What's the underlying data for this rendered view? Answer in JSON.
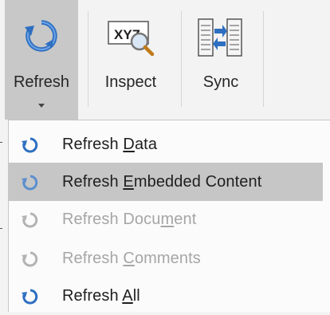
{
  "ribbon": {
    "buttons": [
      {
        "label": "Refresh",
        "icon": "refresh-icon",
        "active": true,
        "has_dropdown": true
      },
      {
        "label": "Inspect",
        "icon": "inspect-xyz-icon"
      },
      {
        "label": "Sync",
        "icon": "sync-icon"
      }
    ]
  },
  "menu": {
    "items": [
      {
        "pre": "Refresh ",
        "key": "D",
        "post": "ata",
        "enabled": true,
        "highlighted": false
      },
      {
        "pre": "Refresh ",
        "key": "E",
        "post": "mbedded Content",
        "enabled": true,
        "highlighted": true
      },
      {
        "pre": "Refresh Docu",
        "key": "m",
        "post": "ent",
        "enabled": false,
        "highlighted": false
      },
      {
        "pre": "Refresh ",
        "key": "C",
        "post": "omments",
        "enabled": false,
        "highlighted": false
      },
      {
        "pre": "Refresh ",
        "key": "A",
        "post": "ll",
        "enabled": true,
        "highlighted": false
      }
    ]
  },
  "colors": {
    "icon_blue": "#2e6fc1",
    "icon_disabled": "#b3b3b3",
    "highlight": "#c6c6c6"
  }
}
